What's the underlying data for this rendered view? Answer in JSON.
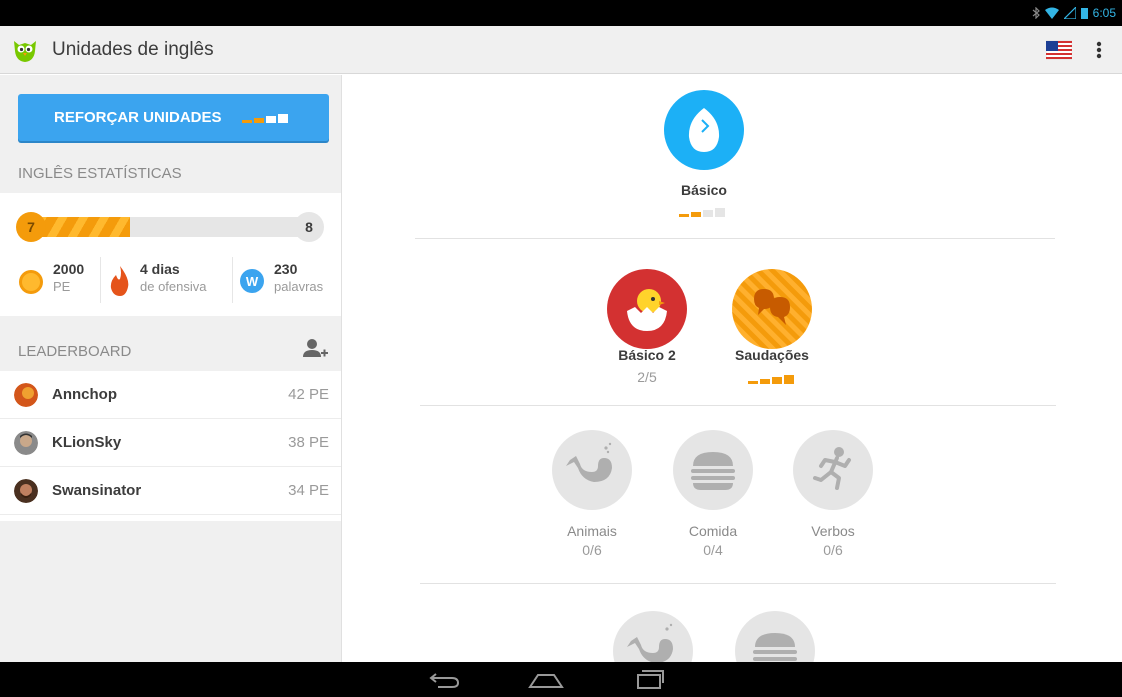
{
  "status_bar": {
    "time": "6:05"
  },
  "app_bar": {
    "title": "Unidades de inglês",
    "logo_icon": "duolingo-owl-icon",
    "flag_icon": "us-flag-icon",
    "menu_icon": "overflow-menu-icon"
  },
  "sidebar": {
    "strengthen_button": "REFORÇAR UNIDADES",
    "stats_header": "INGLÊS ESTATÍSTICAS",
    "level": {
      "current": "7",
      "next": "8",
      "progress": 0.36
    },
    "stats": [
      {
        "value": "2000",
        "label": "PE",
        "icon": "xp-coin-icon"
      },
      {
        "value": "4 dias",
        "label": "de ofensiva",
        "icon": "streak-flame-icon"
      },
      {
        "value": "230",
        "label": "palavras",
        "icon": "words-icon"
      }
    ],
    "leaderboard_header": "LEADERBOARD",
    "leaderboard": [
      {
        "name": "Annchop",
        "xp": "42 PE"
      },
      {
        "name": "KLionSky",
        "xp": "38 PE"
      },
      {
        "name": "Swansinator",
        "xp": "34 PE"
      }
    ]
  },
  "skills": [
    {
      "name": "Básico",
      "sub": "",
      "icon": "egg-icon",
      "color": "#1cb0f6",
      "strength": 2,
      "locked": false
    },
    {
      "name": "Básico 2",
      "sub": "2/5",
      "icon": "hatching-chick-icon",
      "color": "#d33131",
      "strength": 0,
      "locked": false
    },
    {
      "name": "Saudações",
      "sub": "",
      "icon": "speech-bubbles-icon",
      "color": "#f49b0b",
      "strength": 4,
      "locked": false
    },
    {
      "name": "Animais",
      "sub": "0/6",
      "icon": "whale-icon",
      "color": "#e5e5e5",
      "locked": true
    },
    {
      "name": "Comida",
      "sub": "0/4",
      "icon": "burger-icon",
      "color": "#e5e5e5",
      "locked": true
    },
    {
      "name": "Verbos",
      "sub": "0/6",
      "icon": "running-man-icon",
      "color": "#e5e5e5",
      "locked": true
    }
  ],
  "colors": {
    "accent": "#3ba4ef",
    "gold": "#f49b0b",
    "status_blue": "#33b5e5"
  }
}
